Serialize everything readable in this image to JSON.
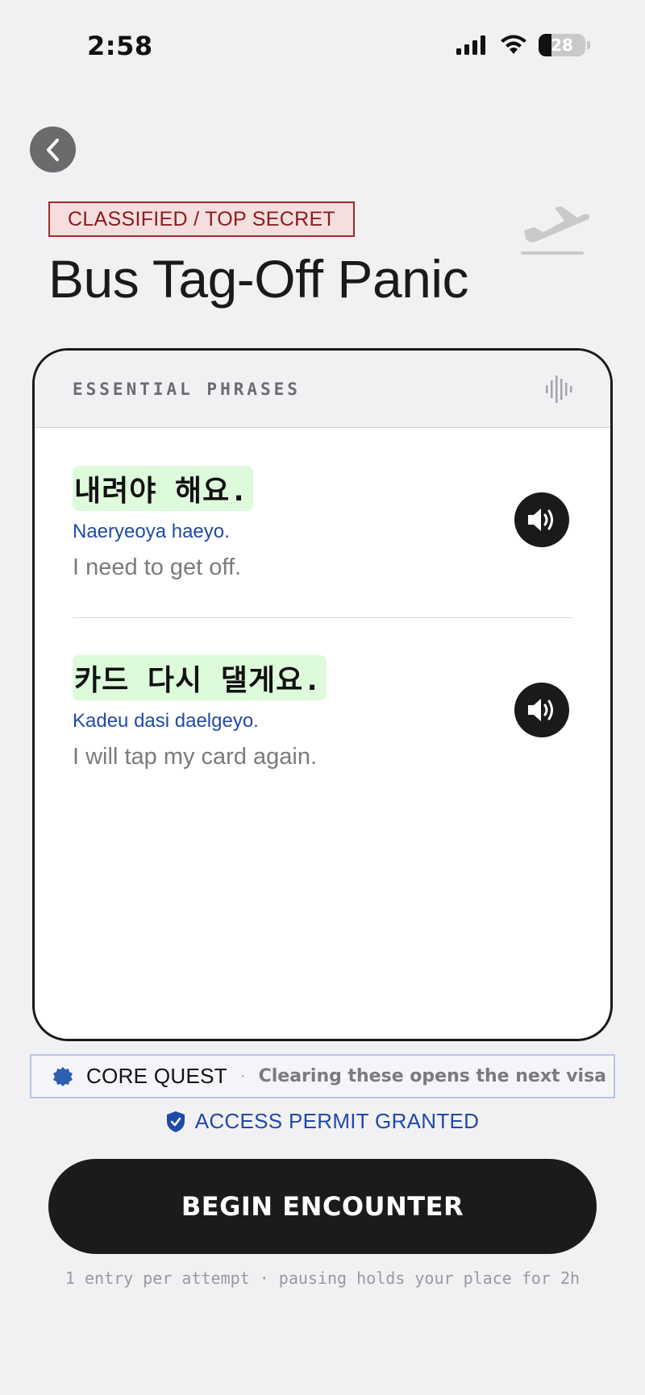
{
  "status_bar": {
    "time": "2:58",
    "battery": "28"
  },
  "header": {
    "badge": "CLASSIFIED / TOP SECRET",
    "title": "Bus Tag-Off Panic"
  },
  "card": {
    "header_label": "ESSENTIAL PHRASES",
    "phrases": [
      {
        "korean": "내려야 해요.",
        "romanization": "Naeryeoya haeyo.",
        "english": "I need to get off."
      },
      {
        "korean": "카드 다시 댈게요.",
        "romanization": "Kadeu dasi daelgeyo.",
        "english": "I will tap my card again."
      }
    ]
  },
  "core_quest": {
    "label": "CORE QUEST",
    "separator": "·",
    "description": "Clearing these opens the next visa"
  },
  "permit": {
    "text": "ACCESS PERMIT GRANTED"
  },
  "cta": {
    "label": "BEGIN ENCOUNTER"
  },
  "footnote": "1 entry per attempt · pausing holds your place for 2h",
  "colors": {
    "accent_blue": "#1f4aa8",
    "secret_red": "#8a1c20",
    "highlight_green": "#ddfadb",
    "button_dark": "#1b1b1d"
  }
}
